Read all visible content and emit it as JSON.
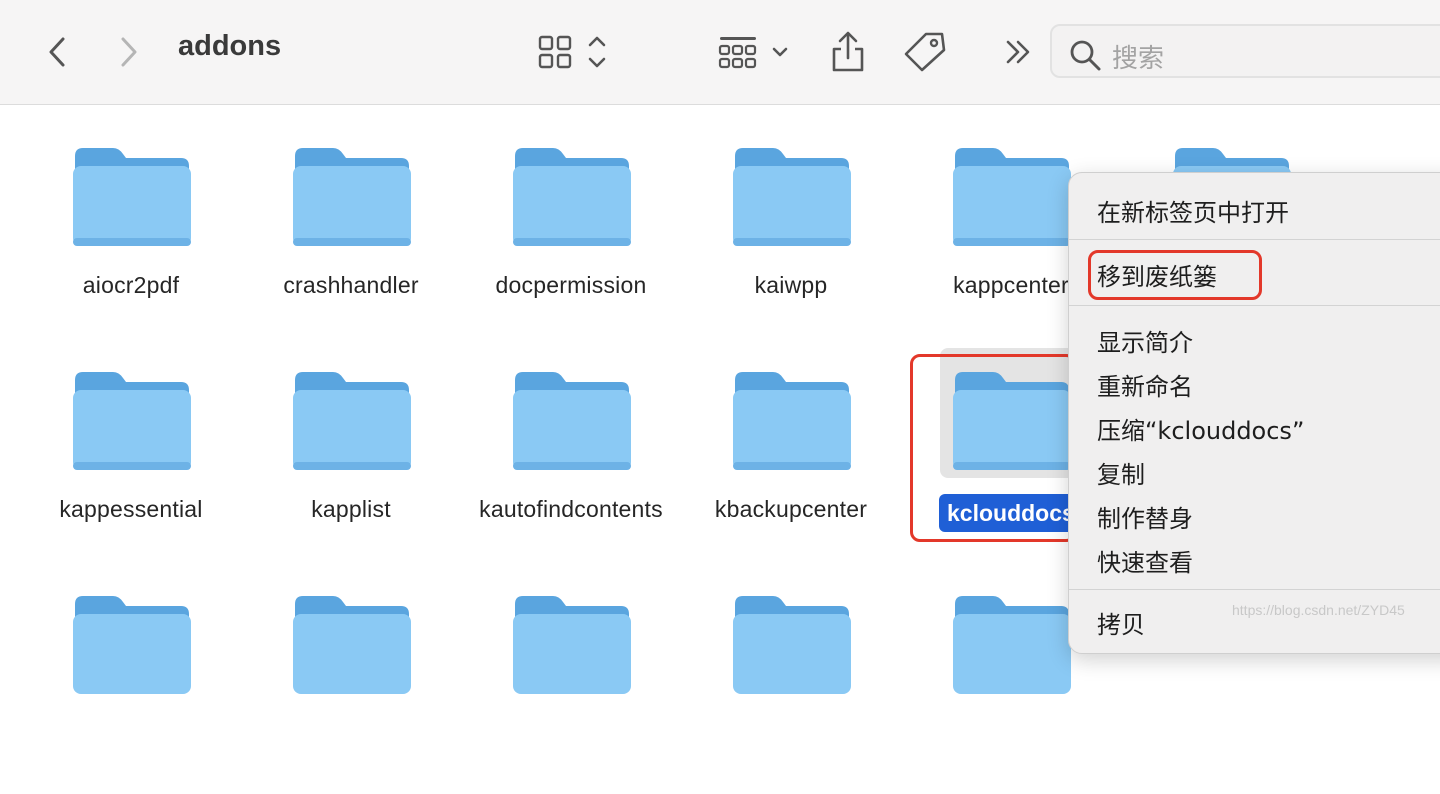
{
  "window": {
    "title": "addons"
  },
  "toolbar": {
    "back_icon": "chevron-left-icon",
    "forward_icon": "chevron-right-icon",
    "view_icon": "grid-view-icon",
    "group_icon": "group-by-icon",
    "share_icon": "share-icon",
    "tag_icon": "tag-icon",
    "more_icon": "double-chevron-right-icon",
    "search_placeholder": "搜索"
  },
  "folders": [
    {
      "name": "aiocr2pdf"
    },
    {
      "name": "crashhandler"
    },
    {
      "name": "docpermission"
    },
    {
      "name": "kaiwpp"
    },
    {
      "name": "kappcenter"
    },
    {
      "name": ""
    },
    {
      "name": "kappessential"
    },
    {
      "name": "kapplist"
    },
    {
      "name": "kautofindcontents"
    },
    {
      "name": "kbackupcenter"
    },
    {
      "name": "kclouddocs"
    }
  ],
  "selected_folder": "kclouddocs",
  "context_menu": {
    "items": [
      "在新标签页中打开",
      "移到废纸篓",
      "显示简介",
      "重新命名",
      "压缩“kclouddocs”",
      "复制",
      "制作替身",
      "快速查看",
      "拷贝"
    ]
  },
  "watermark": "https://blog.csdn.net/ZYD45",
  "colors": {
    "folder_body": "#8ac9f4",
    "folder_tab": "#5aa5df",
    "selection": "#1f5fd6",
    "highlight_box": "#e3382a"
  }
}
